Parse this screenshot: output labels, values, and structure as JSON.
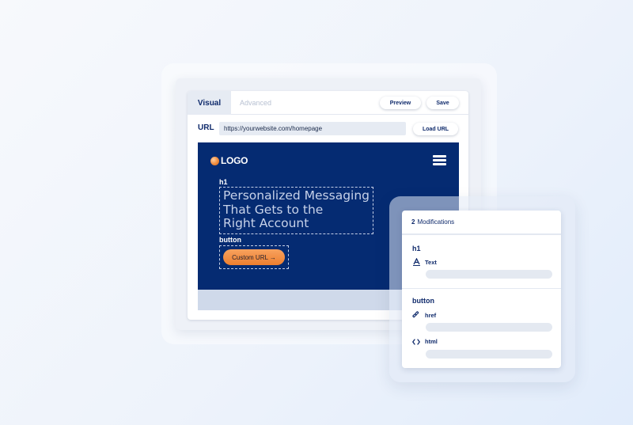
{
  "editor": {
    "tabs": [
      {
        "label": "Visual",
        "active": true
      },
      {
        "label": "Advanced",
        "active": false
      }
    ],
    "preview_label": "Preview",
    "save_label": "Save",
    "url_label": "URL",
    "url_value": "https://yourwebsite.com/homepage",
    "load_url_label": "Load URL"
  },
  "site": {
    "logo_text": "LOGO",
    "h1_tag": "h1",
    "h1_lines": [
      "Personalized Messaging",
      "That Gets to the",
      "Right Account"
    ],
    "button_tag": "button",
    "cta_label": "Custom URL →"
  },
  "modifications": {
    "count": "2",
    "title": "Modifications",
    "sections": [
      {
        "title": "h1",
        "rows": [
          {
            "icon": "text-format-icon",
            "label": "Text"
          }
        ]
      },
      {
        "title": "button",
        "rows": [
          {
            "icon": "link-icon",
            "label": "href"
          },
          {
            "icon": "code-icon",
            "label": "html"
          }
        ]
      }
    ]
  },
  "colors": {
    "navy": "#052b72",
    "accent_orange": "#ee7f2f",
    "text_dark": "#0f2a6b"
  }
}
